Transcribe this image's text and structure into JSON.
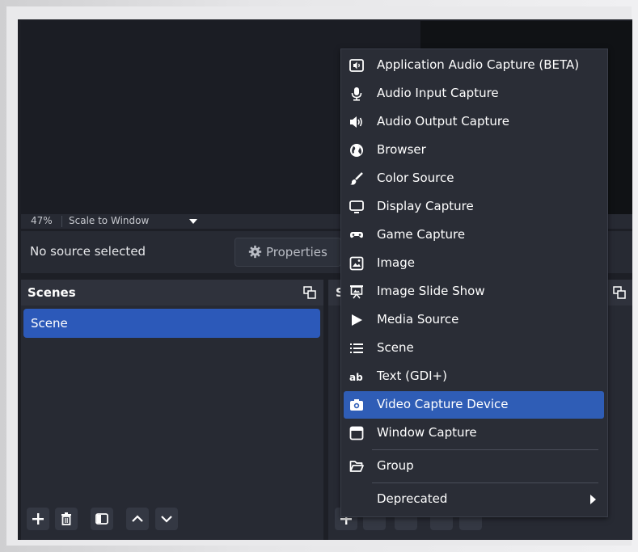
{
  "preview": {
    "zoom": "47%",
    "scale_mode": "Scale to Window"
  },
  "source_bar": {
    "no_source": "No source selected",
    "properties": "Properties"
  },
  "scenes": {
    "title": "Scenes",
    "items": [
      "Scene"
    ]
  },
  "sources": {
    "title_initial": "S"
  },
  "context_menu": {
    "items": [
      {
        "label": "Application Audio Capture (BETA)",
        "icon": "application-audio-icon"
      },
      {
        "label": "Audio Input Capture",
        "icon": "microphone-icon"
      },
      {
        "label": "Audio Output Capture",
        "icon": "speaker-icon"
      },
      {
        "label": "Browser",
        "icon": "globe-icon"
      },
      {
        "label": "Color Source",
        "icon": "paintbrush-icon"
      },
      {
        "label": "Display Capture",
        "icon": "monitor-icon"
      },
      {
        "label": "Game Capture",
        "icon": "gamepad-icon"
      },
      {
        "label": "Image",
        "icon": "image-icon"
      },
      {
        "label": "Image Slide Show",
        "icon": "slideshow-icon"
      },
      {
        "label": "Media Source",
        "icon": "play-icon"
      },
      {
        "label": "Scene",
        "icon": "list-icon"
      },
      {
        "label": "Text (GDI+)",
        "icon": "text-ab-icon"
      },
      {
        "label": "Video Capture Device",
        "icon": "camera-icon",
        "highlighted": true
      },
      {
        "label": "Window Capture",
        "icon": "window-icon"
      }
    ],
    "group": {
      "label": "Group",
      "icon": "folder-icon"
    },
    "deprecated": {
      "label": "Deprecated",
      "icon": "chevron-right-icon"
    }
  },
  "colors": {
    "highlight": "#2f5db6",
    "scene_selected": "#2c59b9",
    "panel": "#272a33",
    "background": "#1d1f26"
  }
}
